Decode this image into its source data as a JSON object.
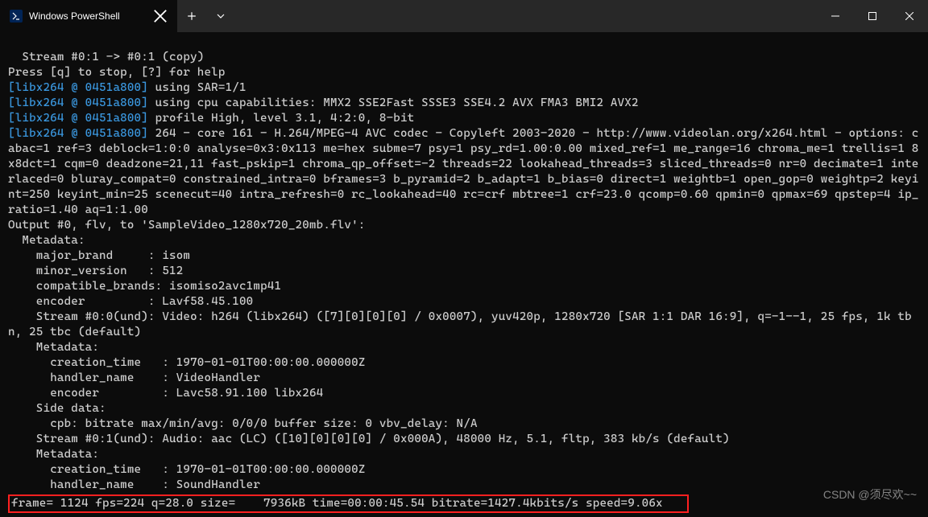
{
  "window": {
    "tab_title": "Windows PowerShell"
  },
  "lines": {
    "l0": "  Stream #0:1 -> #0:1 (copy)",
    "l1": "Press [q] to stop, [?] for help",
    "p0a": "[libx264 @ 0451a800]",
    "p0b": " using SAR=1/1",
    "p1a": "[libx264 @ 0451a800]",
    "p1b": " using cpu capabilities: MMX2 SSE2Fast SSSE3 SSE4.2 AVX FMA3 BMI2 AVX2",
    "p2a": "[libx264 @ 0451a800]",
    "p2b": " profile High, level 3.1, 4:2:0, 8-bit",
    "p3a": "[libx264 @ 0451a800]",
    "p3b": " 264 - core 161 - H.264/MPEG-4 AVC codec - Copyleft 2003-2020 - http://www.videolan.org/x264.html - options: cabac=1 ref=3 deblock=1:0:0 analyse=0x3:0x113 me=hex subme=7 psy=1 psy_rd=1.00:0.00 mixed_ref=1 me_range=16 chroma_me=1 trellis=1 8x8dct=1 cqm=0 deadzone=21,11 fast_pskip=1 chroma_qp_offset=-2 threads=22 lookahead_threads=3 sliced_threads=0 nr=0 decimate=1 interlaced=0 bluray_compat=0 constrained_intra=0 bframes=3 b_pyramid=2 b_adapt=1 b_bias=0 direct=1 weightb=1 open_gop=0 weightp=2 keyint=250 keyint_min=25 scenecut=40 intra_refresh=0 rc_lookahead=40 rc=crf mbtree=1 crf=23.0 qcomp=0.60 qpmin=0 qpmax=69 qpstep=4 ip_ratio=1.40 aq=1:1.00",
    "l2": "Output #0, flv, to 'SampleVideo_1280x720_20mb.flv':",
    "l3": "  Metadata:",
    "l4": "    major_brand     : isom",
    "l5": "    minor_version   : 512",
    "l6": "    compatible_brands: isomiso2avc1mp41",
    "l7": "    encoder         : Lavf58.45.100",
    "l8": "    Stream #0:0(und): Video: h264 (libx264) ([7][0][0][0] / 0x0007), yuv420p, 1280x720 [SAR 1:1 DAR 16:9], q=-1--1, 25 fps, 1k tbn, 25 tbc (default)",
    "l9": "    Metadata:",
    "l10": "      creation_time   : 1970-01-01T00:00:00.000000Z",
    "l11": "      handler_name    : VideoHandler",
    "l12": "      encoder         : Lavc58.91.100 libx264",
    "l13": "    Side data:",
    "l14": "      cpb: bitrate max/min/avg: 0/0/0 buffer size: 0 vbv_delay: N/A",
    "l15": "    Stream #0:1(und): Audio: aac (LC) ([10][0][0][0] / 0x000A), 48000 Hz, 5.1, fltp, 383 kb/s (default)",
    "l16": "    Metadata:",
    "l17": "      creation_time   : 1970-01-01T00:00:00.000000Z",
    "l18": "      handler_name    : SoundHandler",
    "progress": "frame= 1124 fps=224 q=28.0 size=    7936kB time=00:00:45.54 bitrate=1427.4kbits/s speed=9.06x"
  },
  "watermark": "CSDN @须尽欢~~"
}
